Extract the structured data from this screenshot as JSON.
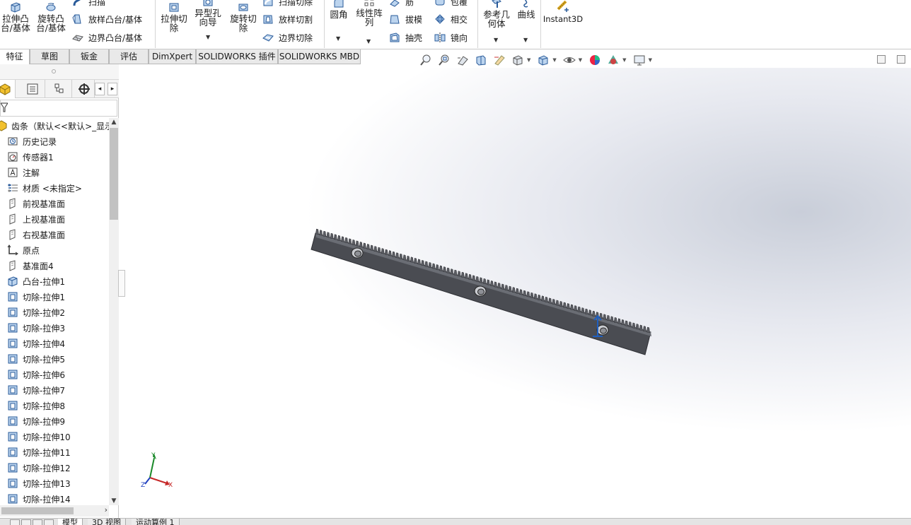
{
  "ribbon": {
    "boss_extrude": "拉伸凸\n台/基体",
    "revolve_boss": "旋转凸\n台/基体",
    "sweep": "扫描",
    "loft_boss": "放样凸台/基体",
    "boundary_boss": "边界凸台/基体",
    "extruded_cut": "拉伸切\n除",
    "hole_wizard": "异型孔\n向导",
    "revolved_cut": "旋转切\n除",
    "swept_cut": "扫描切除",
    "lofted_cut": "放样切割",
    "boundary_cut": "边界切除",
    "fillet": "圆角",
    "linear_pattern": "线性阵\n列",
    "rib": "筋",
    "draft": "拔模",
    "shell": "抽壳",
    "wrap": "包覆",
    "intersect": "相交",
    "mirror": "镜向",
    "ref_geometry": "参考几\n何体",
    "curves": "曲线",
    "instant3d": "Instant3D"
  },
  "tabs": [
    "特征",
    "草图",
    "钣金",
    "评估",
    "DimXpert",
    "SOLIDWORKS 插件",
    "SOLIDWORKS MBD"
  ],
  "tree": {
    "root": "齿条（默认<<默认>_显示",
    "items": [
      {
        "label": "历史记录",
        "icon": "history-icon"
      },
      {
        "label": "传感器1",
        "icon": "sensor-icon"
      },
      {
        "label": "注解",
        "icon": "annotation-icon"
      },
      {
        "label": "材质 <未指定>",
        "icon": "material-icon"
      },
      {
        "label": "前视基准面",
        "icon": "plane-icon"
      },
      {
        "label": "上视基准面",
        "icon": "plane-icon"
      },
      {
        "label": "右视基准面",
        "icon": "plane-icon"
      },
      {
        "label": "原点",
        "icon": "origin-icon"
      },
      {
        "label": "基准面4",
        "icon": "plane-icon"
      },
      {
        "label": "凸台-拉伸1",
        "icon": "boss-extrude-icon"
      },
      {
        "label": "切除-拉伸1",
        "icon": "cut-extrude-icon"
      },
      {
        "label": "切除-拉伸2",
        "icon": "cut-extrude-icon"
      },
      {
        "label": "切除-拉伸3",
        "icon": "cut-extrude-icon"
      },
      {
        "label": "切除-拉伸4",
        "icon": "cut-extrude-icon"
      },
      {
        "label": "切除-拉伸5",
        "icon": "cut-extrude-icon"
      },
      {
        "label": "切除-拉伸6",
        "icon": "cut-extrude-icon"
      },
      {
        "label": "切除-拉伸7",
        "icon": "cut-extrude-icon"
      },
      {
        "label": "切除-拉伸8",
        "icon": "cut-extrude-icon"
      },
      {
        "label": "切除-拉伸9",
        "icon": "cut-extrude-icon"
      },
      {
        "label": "切除-拉伸10",
        "icon": "cut-extrude-icon"
      },
      {
        "label": "切除-拉伸11",
        "icon": "cut-extrude-icon"
      },
      {
        "label": "切除-拉伸12",
        "icon": "cut-extrude-icon"
      },
      {
        "label": "切除-拉伸13",
        "icon": "cut-extrude-icon"
      },
      {
        "label": "切除-拉伸14",
        "icon": "cut-extrude-icon"
      }
    ]
  },
  "bottom_tabs": [
    "模型",
    "3D 视图",
    "运动算例 1"
  ],
  "triad": {
    "x": "X",
    "y": "Y",
    "z": "Z"
  },
  "colors": {
    "accent_blue": "#1f5fbf",
    "part_gray": "#4a4c52",
    "feature_yellow": "#f2c12e"
  }
}
